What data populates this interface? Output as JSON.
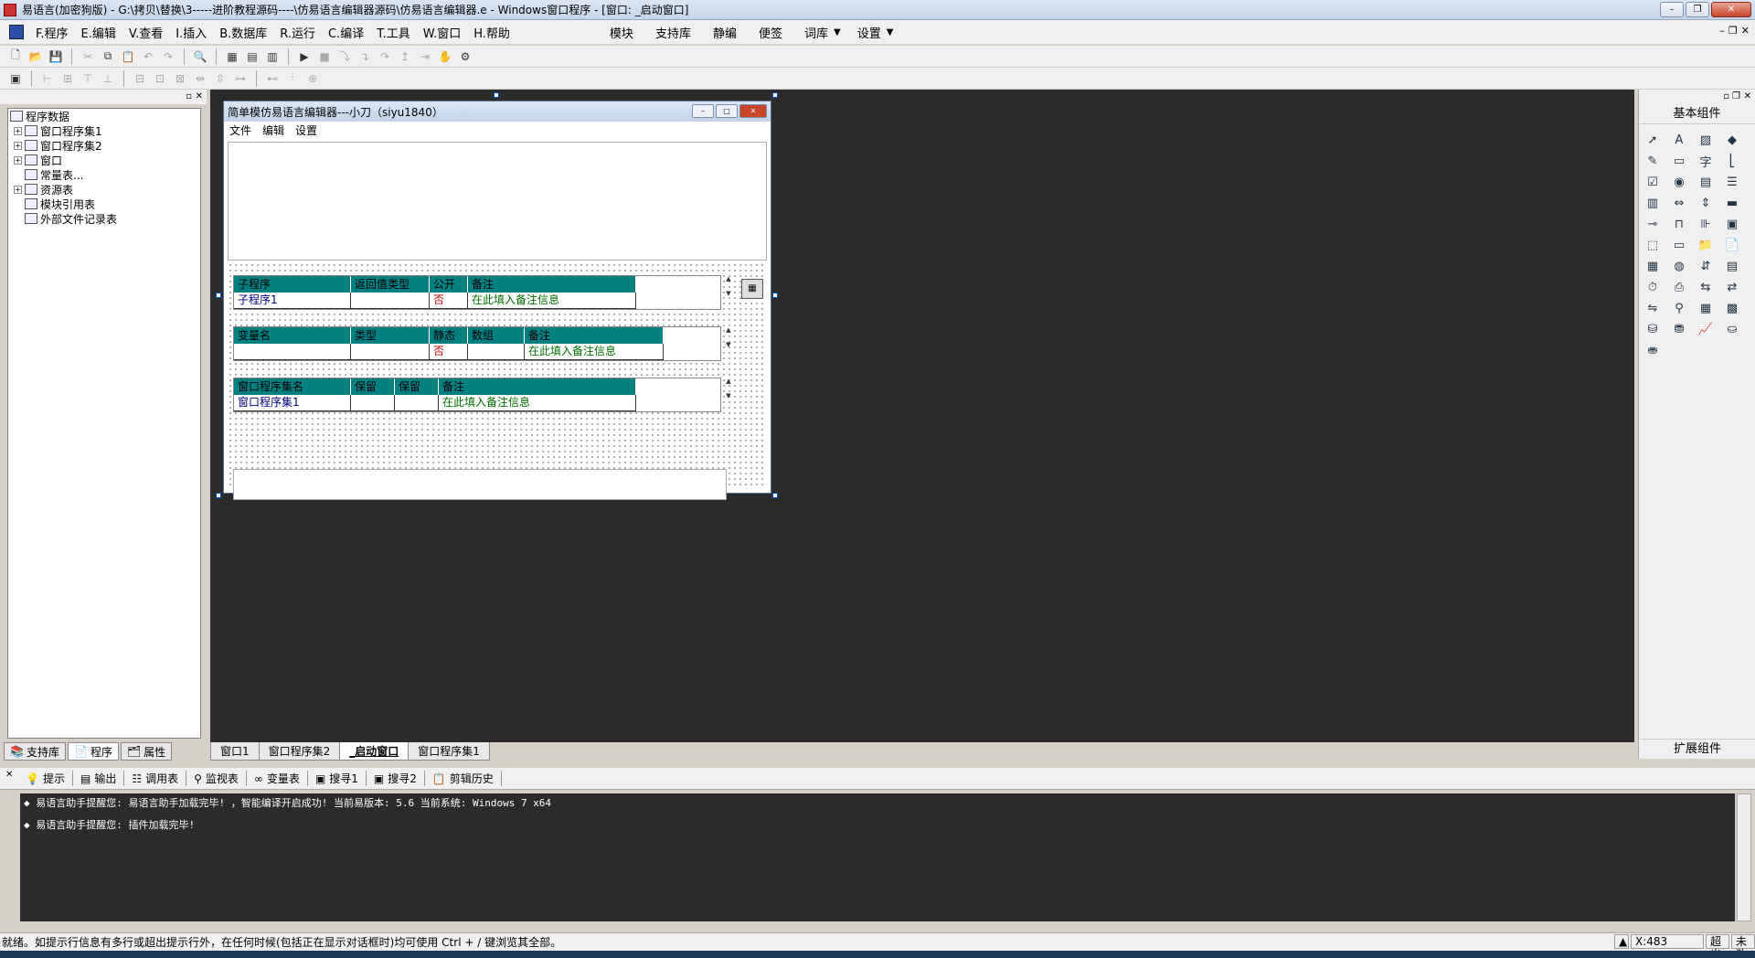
{
  "window": {
    "title": "易语言(加密狗版) - G:\\拷贝\\替换\\3-----进阶教程源码----\\仿易语言编辑器源码\\仿易语言编辑器.e - Windows窗口程序 - [窗口: _启动窗口]",
    "min": "–",
    "max": "❐",
    "close": "✕"
  },
  "menubar": {
    "items": [
      "F.程序",
      "E.编辑",
      "V.查看",
      "I.插入",
      "B.数据库",
      "R.运行",
      "C.编译",
      "T.工具",
      "W.窗口",
      "H.帮助"
    ],
    "right_items": [
      "模块",
      "支持库",
      "静编",
      "便签",
      "词库",
      "设置"
    ],
    "dropdown": "▼"
  },
  "tree": {
    "root": "程序数据",
    "nodes": [
      "窗口程序集1",
      "窗口程序集2",
      "窗口",
      "常量表...",
      "资源表",
      "模块引用表",
      "外部文件记录表"
    ]
  },
  "left_tabs": [
    "支持库",
    "程序",
    "属性"
  ],
  "form": {
    "title": "简单模仿易语言编辑器---小刀（siyu1840）",
    "menu": [
      "文件",
      "编辑",
      "设置"
    ],
    "table1": {
      "headers": [
        "子程序",
        "返回值类型",
        "公开",
        "备注"
      ],
      "row": [
        "子程序1",
        "",
        "否",
        "在此填入备注信息"
      ]
    },
    "table2": {
      "headers": [
        "变量名",
        "类型",
        "静态",
        "数组",
        "备注"
      ],
      "row": [
        "",
        "",
        "否",
        "",
        "在此填入备注信息"
      ]
    },
    "table3": {
      "headers": [
        "窗口程序集名",
        "保留",
        "保留",
        "备注"
      ],
      "row": [
        "窗口程序集1",
        "",
        "",
        "在此填入备注信息"
      ]
    }
  },
  "bottom_tabs": [
    "窗口1",
    "窗口程序集2",
    "_启动窗口",
    "窗口程序集1"
  ],
  "right_panel": {
    "title": "基本组件",
    "footer": "扩展组件"
  },
  "output_tabs": [
    "提示",
    "输出",
    "调用表",
    "监视表",
    "变量表",
    "搜寻1",
    "搜寻2",
    "剪辑历史"
  ],
  "output_lines": [
    "◆ 易语言助手提醒您: 易语言助手加载完毕! ，智能编译开启成功! 当前易版本: 5.6 当前系统: Windows 7 x64",
    "◆ 易语言助手提醒您: 插件加载完毕!"
  ],
  "status": {
    "text": "就绪。如提示行信息有多行或超出提示行外，在任何时候(包括正在显示对话框时)均可使用 Ctrl + / 键浏览其全部。",
    "coord": "X:483",
    "mode": "超出",
    "state": "未改"
  }
}
